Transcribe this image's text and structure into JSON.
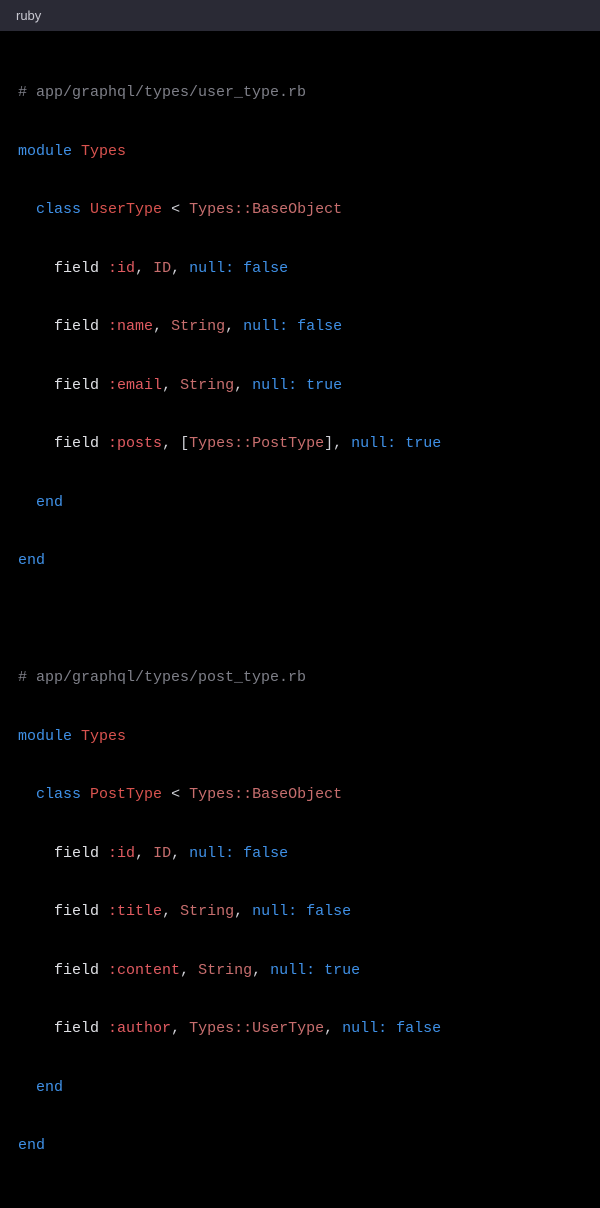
{
  "header": {
    "language_label": "ruby"
  },
  "code": {
    "comment1": "# app/graphql/types/user_type.rb",
    "module_kw": "module",
    "types_mod": "Types",
    "class_kw": "class",
    "user_type": "UserType",
    "lt": "<",
    "base_object": "Types::BaseObject",
    "field_kw": "field",
    "sym_id": ":id",
    "id_type": "ID",
    "null_kw": "null:",
    "false_kw": "false",
    "true_kw": "true",
    "sym_name": ":name",
    "string_type": "String",
    "sym_email": ":email",
    "sym_posts": ":posts",
    "posts_arr_l": "[",
    "posts_arr_type": "Types::PostType",
    "posts_arr_r": "]",
    "end_kw": "end",
    "comment2": "# app/graphql/types/post_type.rb",
    "post_type": "PostType",
    "sym_title": ":title",
    "sym_content": ":content",
    "sym_author": ":author",
    "user_type_ref": "Types::UserType",
    "comma": ", "
  }
}
